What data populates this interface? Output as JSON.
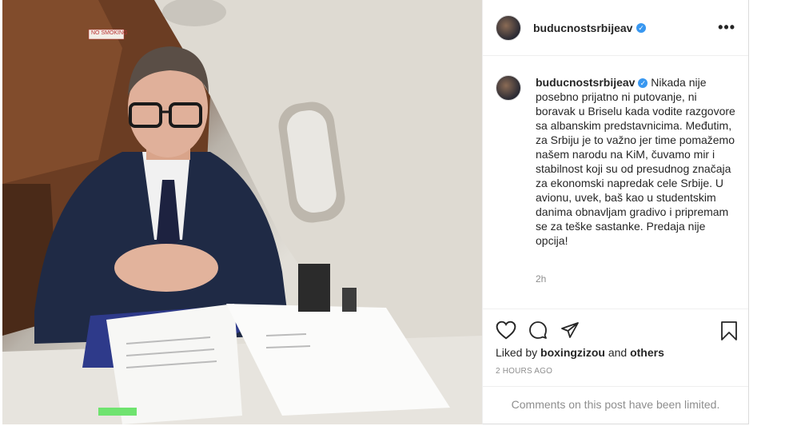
{
  "photo": {
    "sign_text": "NO SMOKING"
  },
  "header": {
    "username": "buducnostsrbijeav",
    "more_label": "•••"
  },
  "post": {
    "caption_username": "buducnostsrbijeav",
    "caption_text": "Nikada nije posebno prijatno ni putovanje, ni boravak u Briselu kada vodite razgovore sa albanskim predstavnicima. Međutim, za Srbiju je to važno jer time pomažemo našem narodu na KiM, čuvamo mir i stabilnost koji su od presudnog značaja za ekonomski napredak cele Srbije. U avionu, uvek, baš kao u studentskim danima obnavljam gradivo i pripremam se za teške sastanke. Predaja nije opcija!",
    "caption_time": "2h"
  },
  "actions": {
    "liked_by_prefix": "Liked by",
    "liked_by_user": "boxingzizou",
    "liked_by_and": "and",
    "liked_by_others": "others",
    "posted_time": "2 HOURS AGO",
    "comments_limited": "Comments on this post have been limited."
  },
  "colors": {
    "verified": "#3897f0",
    "muted_text": "#8e8e8e",
    "border": "#efefef"
  }
}
